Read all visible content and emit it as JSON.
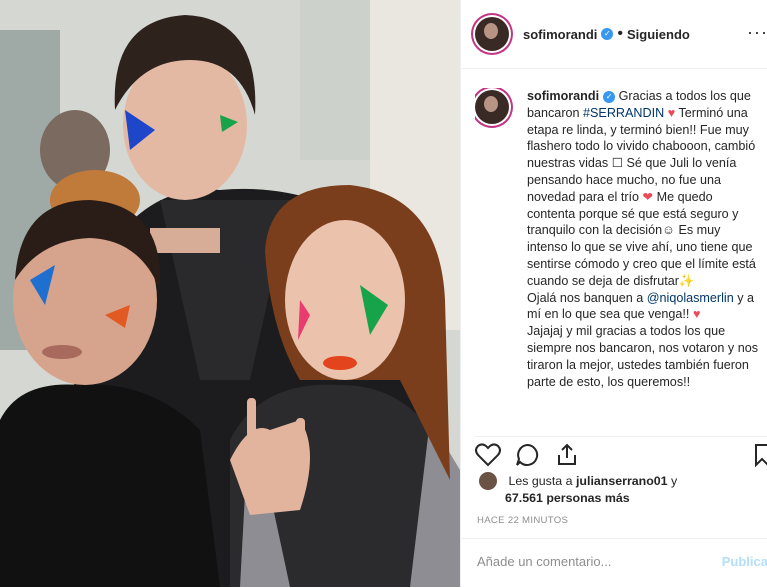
{
  "post": {
    "username": "sofimorandi",
    "following_label": "Siguiendo",
    "separator": "•",
    "more_label": "···"
  },
  "caption": {
    "author": "sofimorandi",
    "line1": "Gracias a todos los que bancaron",
    "hashtag": "#SERRANDIN",
    "line2": "Terminó una etapa re linda, y terminó bien!! Fue muy flashero todo lo vivido chabooon, cambió nuestras vidas ☐ Sé que Juli lo venía pensando hace mucho, no fue una novedad para el trío",
    "line3": "Me quedo contenta porque sé que está seguro y tranquilo con la decisión☺ Es muy intenso lo que se vive ahí, uno tiene que sentirse cómodo y creo que el límite está cuando se deja de disfrutar✨",
    "line4": "Ojalá nos banquen a",
    "mention": "@niqolasmerlin",
    "line5": "y a mí en lo que sea que venga!!",
    "line6": "Jajajaj y mil gracias a todos los que siempre nos bancaron, nos votaron y nos tiraron la mejor, ustedes también fueron parte de esto, los queremos!!"
  },
  "likes": {
    "prefix": "Les gusta a",
    "user": "julianserrano01",
    "joiner": "y",
    "count": "67.561 personas más"
  },
  "timestamp": "HACE 22 MINUTOS",
  "comment_box": {
    "placeholder": "Añade un comentario...",
    "publish_label": "Publica"
  },
  "icons": [
    "heart-icon",
    "comment-icon",
    "share-icon",
    "bookmark-icon",
    "verified-badge-icon"
  ],
  "colors": {
    "link": "#003569",
    "verified": "#3897f0",
    "heart": "#ed4956",
    "publish": "#b2dffc"
  }
}
